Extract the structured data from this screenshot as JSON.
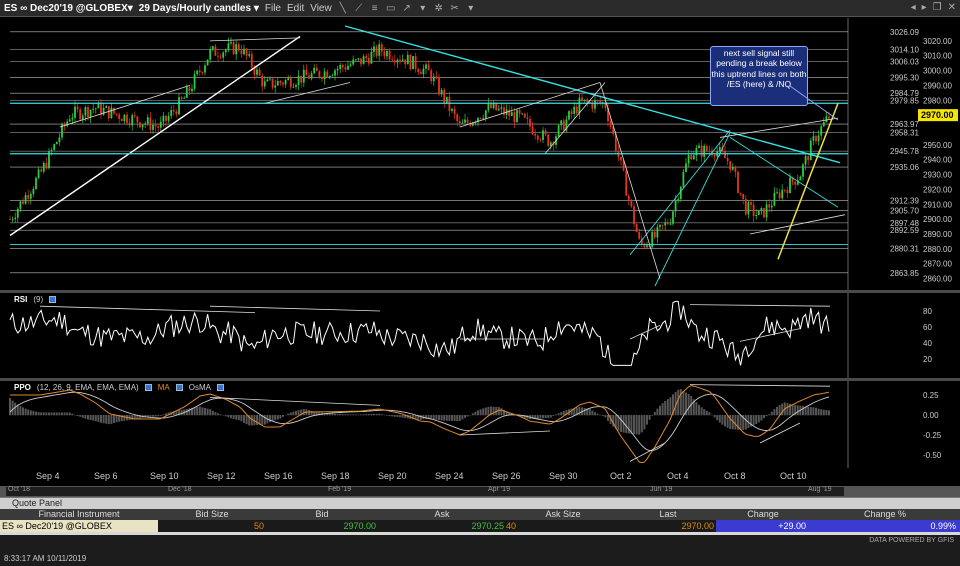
{
  "toolbar": {
    "symbol": "ES ∞ Dec20'19 @GLOBEX▾",
    "period": "29 Days/Hourly candles ▾",
    "menus": [
      "File",
      "Edit",
      "View"
    ]
  },
  "main_chart": {
    "current_price": "2970.00",
    "price_labels": [
      "3026.09",
      "3020.00",
      "3014.10",
      "3010.00",
      "3006.03",
      "3000.00",
      "2995.30",
      "2990.00",
      "2984.79",
      "2979.85",
      "2980.00",
      "2963.97",
      "2958.31",
      "2950.00",
      "2945.78",
      "2940.00",
      "2935.06",
      "2930.00",
      "2920.00",
      "2912.39",
      "2910.00",
      "2905.70",
      "2900.00",
      "2897.48",
      "2892.59",
      "2890.00",
      "2880.31",
      "2880.00",
      "2870.00",
      "2863.85",
      "2860.00"
    ],
    "callout": "next sell signal still pending a break below this uptrend lines on both /ES (here) & /NQ"
  },
  "rsi": {
    "title": "RSI",
    "params": "(9)",
    "levels": [
      "80",
      "60",
      "40",
      "20"
    ]
  },
  "ppo": {
    "title": "PPO",
    "params": "(12, 26, 9, EMA, EMA, EMA)",
    "legend_ma": "MA",
    "legend_osma": "OsMA",
    "levels": [
      "0.25",
      "0.00",
      "-0.25",
      "-0.50"
    ]
  },
  "date_axis": [
    "Sep 4",
    "Sep 6",
    "Sep 10",
    "Sep 12",
    "Sep 16",
    "Sep 18",
    "Sep 20",
    "Sep 24",
    "Sep 26",
    "Sep 30",
    "Oct 2",
    "Oct 4",
    "Oct 8",
    "Oct 10"
  ],
  "scroller_labels": [
    "Oct '18",
    "Dec '18",
    "Feb '19",
    "Apr '19",
    "Jun '19",
    "Aug '19"
  ],
  "quote_panel": {
    "title": "Quote Panel",
    "headers": [
      "Financial Instrument",
      "Bid Size",
      "Bid",
      "Ask",
      "Ask Size",
      "Last",
      "Change",
      "Change %"
    ],
    "row": {
      "instrument": "ES ∞ Dec20'19 @GLOBEX",
      "bid_size": "50",
      "bid": "2970.00",
      "ask": "2970.25",
      "ask_size": "40",
      "last": "2970.00",
      "change": "+29.00",
      "change_pct": "0.99%"
    }
  },
  "status": {
    "time": "8:33:17 AM 10/11/2019",
    "brand": "DATA POWERED BY GFIS"
  },
  "colors": {
    "up_candle": "#2ecc40",
    "down_candle": "#e8341c",
    "trendline_cyan": "#33e0e0",
    "trendline_yellow": "#f0e040",
    "rsi_line": "#ffffff",
    "ppo_line": "#e08a2c",
    "ppo_signal": "#cccccc",
    "price_tag": "#f5e600"
  }
}
